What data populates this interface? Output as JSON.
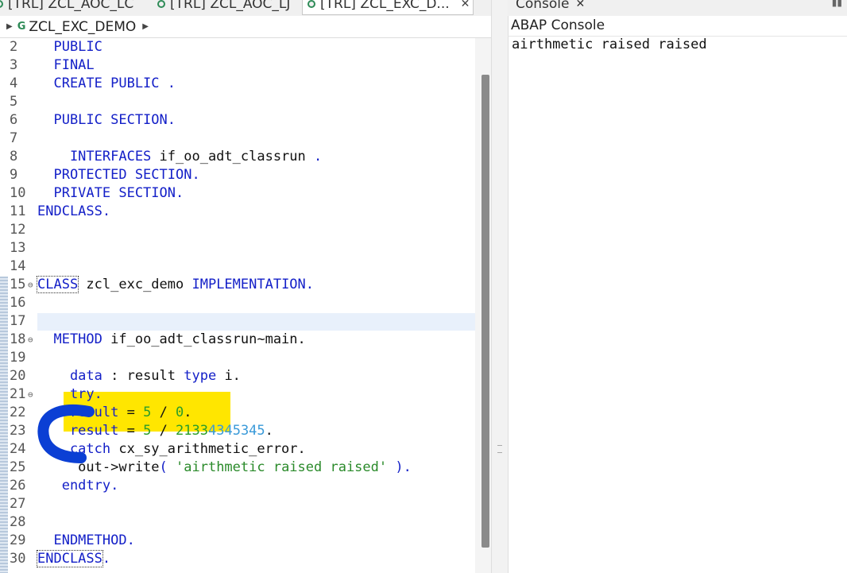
{
  "editor_tabs": [
    {
      "label": "[TRL] ZCL_AOC_LC",
      "active": false
    },
    {
      "label": "[TRL] ZCL_AOC_LJ",
      "active": false
    },
    {
      "label": "[TRL] ZCL_EXC_D...",
      "active": true
    }
  ],
  "breadcrumb": {
    "class_name": "ZCL_EXC_DEMO",
    "icon": "class-icon"
  },
  "code_lines": [
    {
      "n": "2",
      "parts": [
        [
          "kw",
          "  PUBLIC"
        ]
      ]
    },
    {
      "n": "3",
      "parts": [
        [
          "kw",
          "  FINAL"
        ]
      ]
    },
    {
      "n": "4",
      "parts": [
        [
          "kw",
          "  CREATE PUBLIC ."
        ]
      ]
    },
    {
      "n": "5",
      "parts": []
    },
    {
      "n": "6",
      "parts": [
        [
          "kw",
          "  PUBLIC SECTION."
        ]
      ]
    },
    {
      "n": "7",
      "parts": []
    },
    {
      "n": "8",
      "parts": [
        [
          "kw",
          "    INTERFACES "
        ],
        [
          "id",
          "if_oo_adt_classrun"
        ],
        [
          "kw",
          " ."
        ]
      ]
    },
    {
      "n": "9",
      "parts": [
        [
          "kw",
          "  PROTECTED SECTION."
        ]
      ]
    },
    {
      "n": "10",
      "parts": [
        [
          "kw",
          "  PRIVATE SECTION."
        ]
      ]
    },
    {
      "n": "11",
      "parts": [
        [
          "kw",
          "ENDCLASS."
        ]
      ]
    },
    {
      "n": "12",
      "parts": []
    },
    {
      "n": "13",
      "parts": []
    },
    {
      "n": "14",
      "parts": []
    },
    {
      "n": "15",
      "fold": true,
      "parts": [
        [
          "kwbox",
          "CLASS"
        ],
        [
          "id",
          " zcl_exc_demo "
        ],
        [
          "kw",
          "IMPLEMENTATION."
        ]
      ]
    },
    {
      "n": "16",
      "parts": []
    },
    {
      "n": "17",
      "parts": []
    },
    {
      "n": "18",
      "fold": true,
      "parts": [
        [
          "kw",
          "  METHOD "
        ],
        [
          "id",
          "if_oo_adt_classrun~main."
        ]
      ]
    },
    {
      "n": "19",
      "parts": []
    },
    {
      "n": "20",
      "parts": [
        [
          "kw",
          "    data "
        ],
        [
          "id",
          ": result "
        ],
        [
          "kw",
          "type "
        ],
        [
          "id",
          "i."
        ]
      ]
    },
    {
      "n": "21",
      "fold": true,
      "parts": [
        [
          "kw",
          "    try."
        ]
      ]
    },
    {
      "n": "22",
      "parts": [
        [
          "kw",
          "    result "
        ],
        [
          "id",
          "= "
        ],
        [
          "num",
          "5"
        ],
        [
          "id",
          " / "
        ],
        [
          "num",
          "0"
        ],
        [
          "id",
          "."
        ]
      ]
    },
    {
      "n": "23",
      "parts": [
        [
          "kw",
          "    result "
        ],
        [
          "id",
          "= "
        ],
        [
          "num",
          "5"
        ],
        [
          "id",
          " / "
        ],
        [
          "num",
          "2133"
        ],
        [
          "num2",
          "4345345"
        ],
        [
          "id",
          "."
        ]
      ]
    },
    {
      "n": "24",
      "parts": [
        [
          "kw",
          "    catch "
        ],
        [
          "id",
          "cx_sy_arithmetic_error."
        ]
      ]
    },
    {
      "n": "25",
      "parts": [
        [
          "id",
          "     out->write"
        ],
        [
          "kw",
          "( "
        ],
        [
          "str",
          "'airthmetic raised raised'"
        ],
        [
          "kw",
          " )."
        ]
      ]
    },
    {
      "n": "26",
      "parts": [
        [
          "kw",
          "   endtry."
        ]
      ]
    },
    {
      "n": "27",
      "parts": []
    },
    {
      "n": "28",
      "parts": []
    },
    {
      "n": "29",
      "parts": [
        [
          "kw",
          "  ENDMETHOD."
        ]
      ]
    },
    {
      "n": "30",
      "parts": [
        [
          "kwbox",
          "ENDCLASS"
        ],
        [
          "kw",
          "."
        ]
      ]
    }
  ],
  "console": {
    "tab_label": "Console",
    "header": "ABAP Console",
    "output": "airthmetic raised raised"
  },
  "colors": {
    "highlight": "#ffe600",
    "annotation": "#0b3fd4",
    "keyword": "#1420c8"
  }
}
